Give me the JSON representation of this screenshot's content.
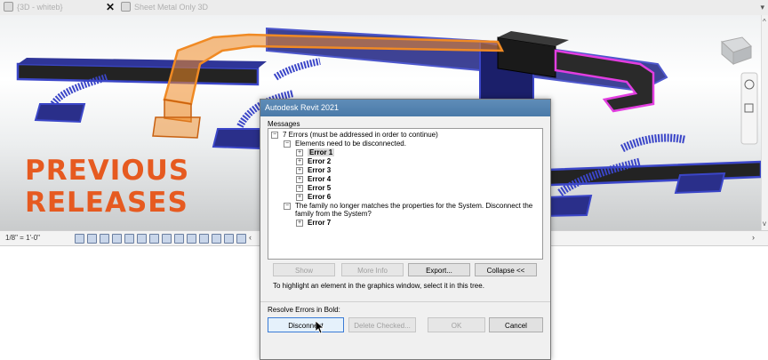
{
  "tabs": [
    {
      "label": "{3D - whiteb}"
    },
    {
      "label": "Sheet Metal Only 3D"
    }
  ],
  "promo": {
    "line1": "PREVIOUS",
    "line2": "RELEASES"
  },
  "statusbar": {
    "scale": "1/8\" = 1'-0\""
  },
  "dialog": {
    "title": "Autodesk Revit 2021",
    "messages_label": "Messages",
    "tree": {
      "root": "7 Errors (must be addressed in order to continue)",
      "group1": {
        "label": "Elements need to be disconnected.",
        "items": [
          "Error 1",
          "Error 2",
          "Error 3",
          "Error 4",
          "Error 5",
          "Error 6"
        ]
      },
      "group2": {
        "line1": "The family no longer matches the properties for the System. Disconnect the",
        "line2": "family from the System?",
        "items": [
          "Error 7"
        ]
      }
    },
    "buttons": {
      "show": "Show",
      "more_info": "More Info",
      "export": "Export...",
      "collapse": "Collapse <<"
    },
    "hint": "To highlight an element in the graphics window, select it in this tree.",
    "resolve_label": "Resolve Errors in Bold:",
    "actions": {
      "disconnect": "Disconnect",
      "delete_checked": "Delete Checked...",
      "ok": "OK",
      "cancel": "Cancel"
    }
  },
  "colors": {
    "selected_duct": "#f08a24",
    "duct_system": "#3b46c8",
    "highlight_duct": "#e23ee0",
    "promo_text": "#e65a20",
    "dialog_title_bar": "#4a7aa8"
  }
}
